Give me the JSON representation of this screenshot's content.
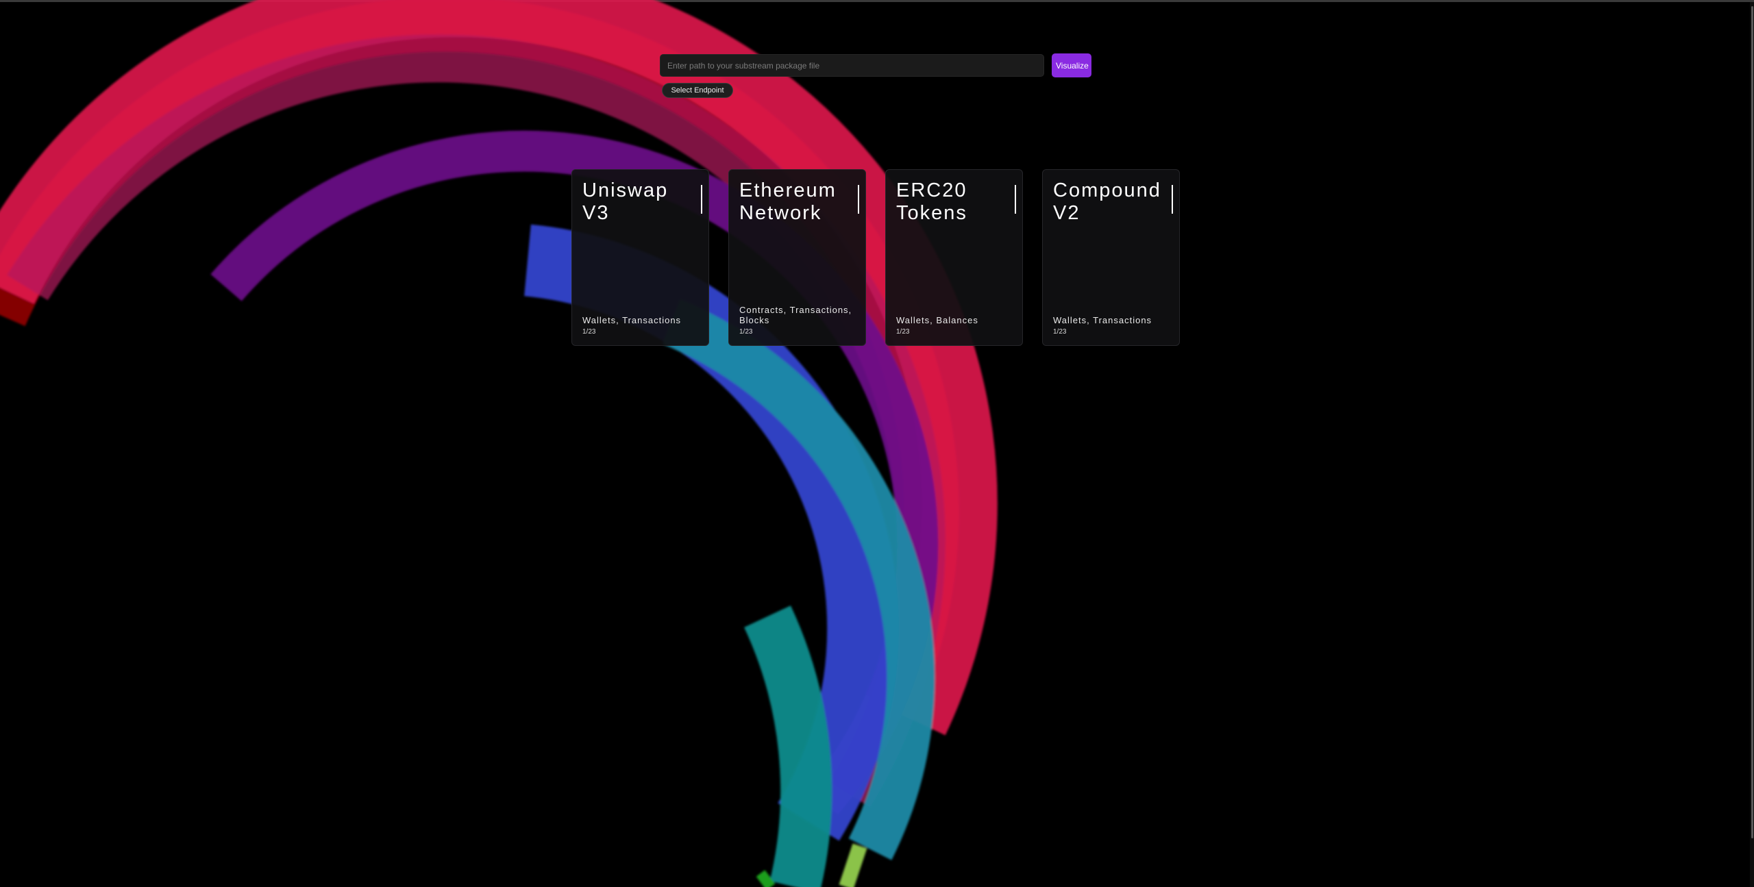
{
  "search": {
    "placeholder": "Enter path to your substream package file",
    "value": ""
  },
  "actions": {
    "visualize_label": "Visualize",
    "select_endpoint_label": "Select Endpoint"
  },
  "colors": {
    "accent": "#8a2be2",
    "background": "#000000",
    "card_background": "#101012"
  },
  "cards": [
    {
      "title": "Uniswap V3",
      "tags": "Wallets, Transactions",
      "page": "1/23"
    },
    {
      "title": "Ethereum Network",
      "tags": "Contracts, Transactions, Blocks",
      "page": "1/23"
    },
    {
      "title": "ERC20 Tokens",
      "tags": "Wallets, Balances",
      "page": "1/23"
    },
    {
      "title": "Compound V2",
      "tags": "Wallets, Transactions",
      "page": "1/23"
    }
  ]
}
